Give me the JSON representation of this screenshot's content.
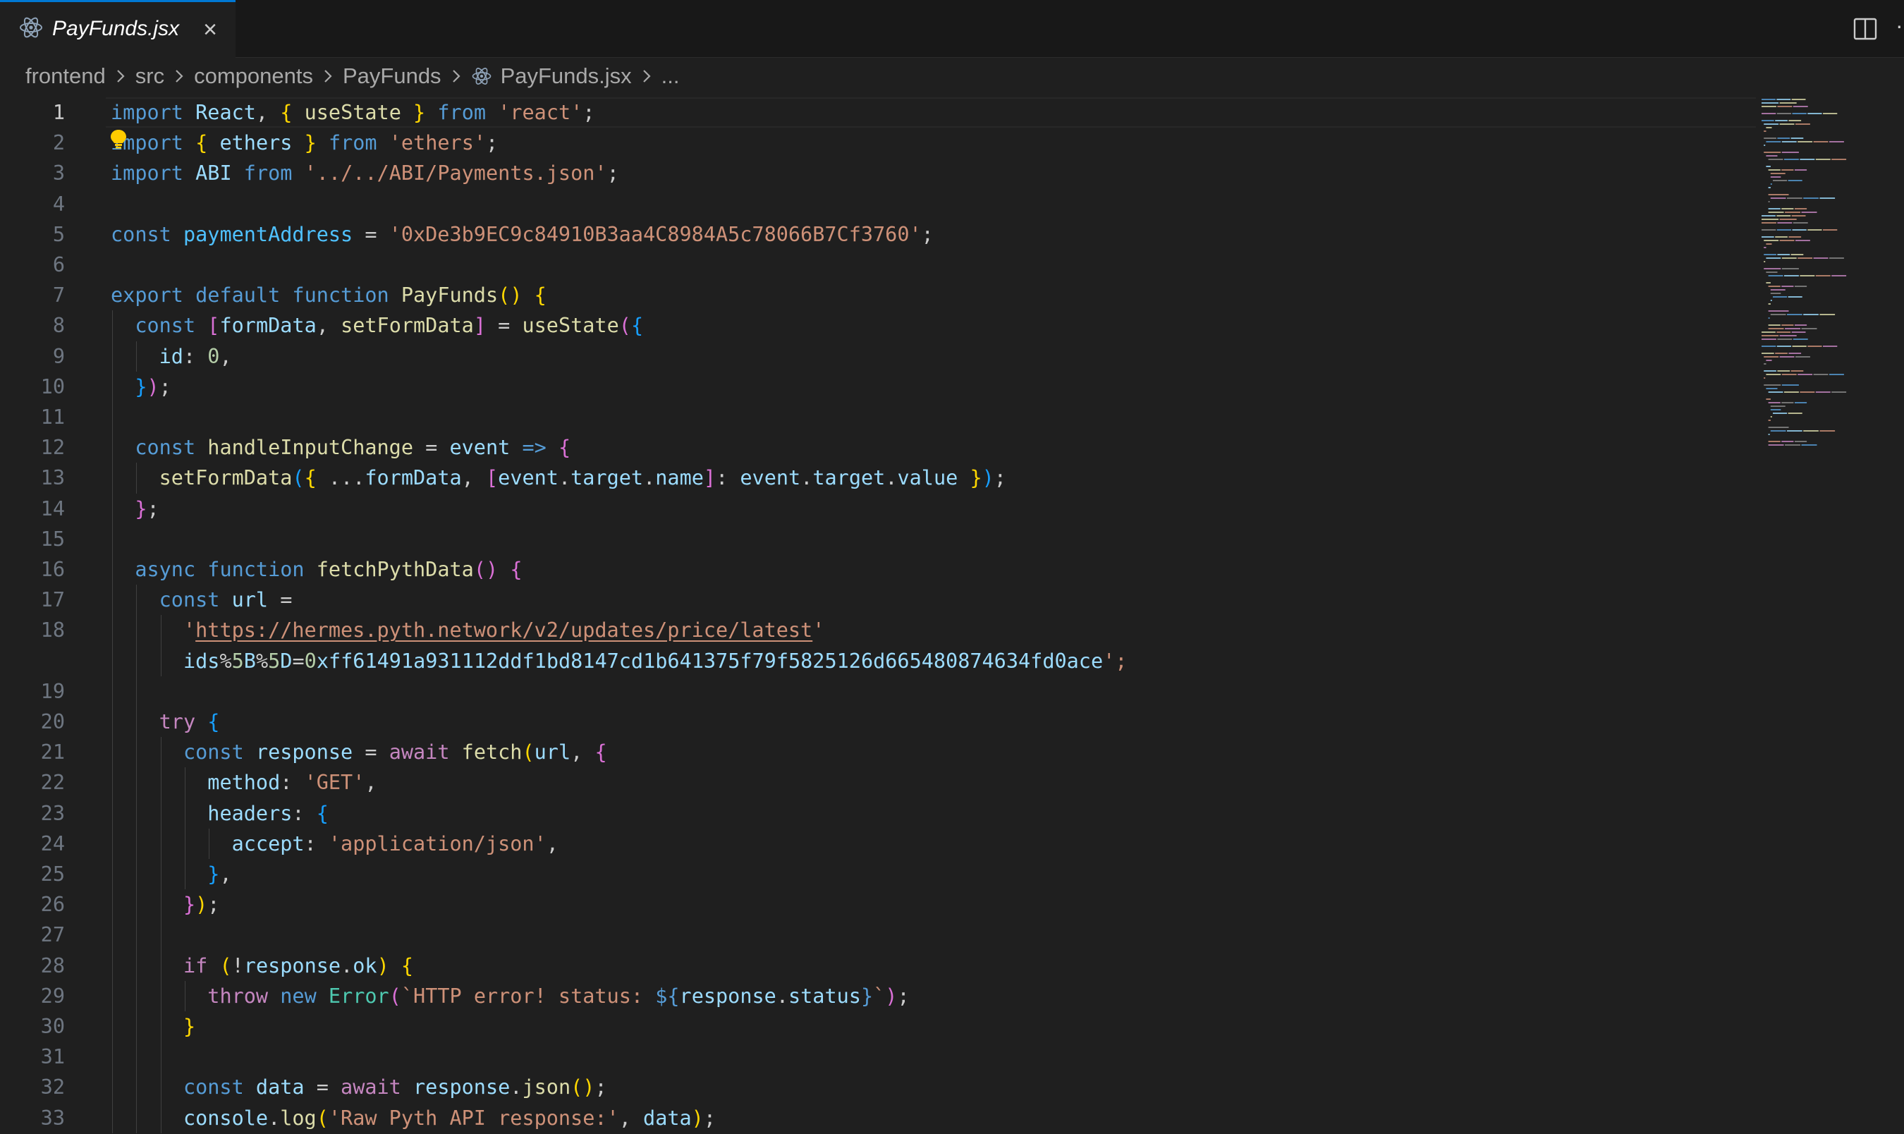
{
  "tab": {
    "label": "PayFunds.jsx",
    "close_icon": "close-icon",
    "file_icon": "react-icon"
  },
  "breadcrumb": [
    "frontend",
    "src",
    "components",
    "PayFunds",
    "PayFunds.jsx",
    "..."
  ],
  "editor": {
    "active_line": 1,
    "line_numbers": [
      "1",
      "2",
      "3",
      "4",
      "5",
      "6",
      "7",
      "8",
      "9",
      "10",
      "11",
      "12",
      "13",
      "14",
      "15",
      "16",
      "17",
      "18",
      "19",
      "20",
      "21",
      "22",
      "23",
      "24",
      "25",
      "26",
      "27",
      "28",
      "29",
      "30",
      "31",
      "32",
      "33"
    ],
    "lines": [
      "import React, { useState } from 'react';",
      "import { ethers } from 'ethers';",
      "import ABI from '../../ABI/Payments.json';",
      "",
      "const paymentAddress = '0xDe3b9EC9c84910B3aa4C8984A5c78066B7Cf3760';",
      "",
      "export default function PayFunds() {",
      "  const [formData, setFormData] = useState({",
      "    id: 0,",
      "  });",
      "",
      "  const handleInputChange = event => {",
      "    setFormData({ ...formData, [event.target.name]: event.target.value });",
      "  };",
      "",
      "  async function fetchPythData() {",
      "    const url =",
      "      'https://hermes.pyth.network/v2/updates/price/latest?ids%5B%5D=0xff61491a931112ddf1bd8147cd1b641375f79f5825126d665480874634fd0ace';",
      "",
      "    try {",
      "      const response = await fetch(url, {",
      "        method: 'GET',",
      "        headers: {",
      "          accept: 'application/json',",
      "        },",
      "      });",
      "",
      "      if (!response.ok) {",
      "        throw new Error(`HTTP error! status: ${response.status}`);",
      "      }",
      "",
      "      const data = await response.json();",
      "      console.log('Raw Pyth API response:', data);"
    ]
  },
  "colors": {
    "editor_bg": "#1f1f1f",
    "keyword": "#569cd6",
    "control": "#c586c0",
    "function": "#dcdcaa",
    "variable": "#9cdcfe",
    "string": "#ce9178",
    "number": "#b5cea8",
    "accent": "#0078d4"
  },
  "icons": {
    "split_editor": "split-editor-icon",
    "more_actions": "more-actions-icon",
    "lightbulb": "lightbulb-icon"
  }
}
